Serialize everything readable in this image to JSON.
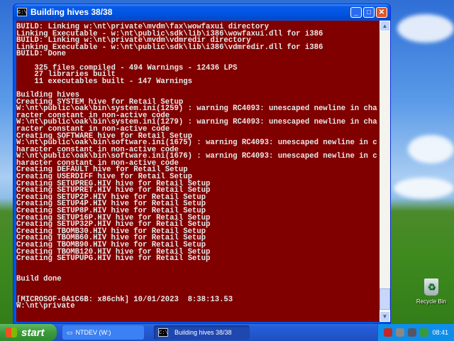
{
  "window": {
    "title": "Building hives 38/38",
    "icon": "C:\\"
  },
  "console_lines": [
    "BUILD: Linking w:\\nt\\private\\mvdm\\fax\\wowfaxui directory",
    "Linking Executable - w:\\nt\\public\\sdk\\lib\\i386\\wowfaxui.dll for i386",
    "BUILD: Linking w:\\nt\\private\\mvdm\\vdmredir directory",
    "Linking Executable - w:\\nt\\public\\sdk\\lib\\i386\\vdmredir.dll for i386",
    "BUILD: Done",
    "",
    "    325 files compiled - 494 Warnings - 12436 LPS",
    "    27 libraries built",
    "    11 executables built - 147 Warnings",
    "",
    "Building hives",
    "Creating SYSTEM hive for Retail Setup",
    "W:\\nt\\public\\oak\\bin\\system.ini(1259) : warning RC4093: unescaped newline in cha",
    "racter constant in non-active code",
    "W:\\nt\\public\\oak\\bin\\system.ini(1279) : warning RC4093: unescaped newline in cha",
    "racter constant in non-active code",
    "Creating SOFTWARE hive for Retail Setup",
    "W:\\nt\\public\\oak\\bin\\software.ini(1675) : warning RC4093: unescaped newline in c",
    "haracter constant in non-active code",
    "W:\\nt\\public\\oak\\bin\\software.ini(1676) : warning RC4093: unescaped newline in c",
    "haracter constant in non-active code",
    "Creating DEFAULT hive for Retail Setup",
    "Creating USERDIFF hive for Retail Setup",
    "Creating SETUPREG.HIV hive for Retail Setup",
    "Creating SETUPRET.HIV hive for Retail Setup",
    "Creating SETUP2P.HIV hive for Retail Setup",
    "Creating SETUP4P.HIV hive for Retail Setup",
    "Creating SETUP8P.HIV hive for Retail Setup",
    "Creating SETUP16P.HIV hive for Retail Setup",
    "Creating SETUP32P.HIV hive for Retail Setup",
    "Creating TBOMB30.HIV hive for Retail Setup",
    "Creating TBOMB60.HIV hive for Retail Setup",
    "Creating TBOMB90.HIV hive for Retail Setup",
    "Creating TBOMB120.HIV hive for Retail Setup",
    "Creating SETUPUPG.HIV hive for Retail Setup",
    "",
    "",
    "Build done",
    "",
    "",
    "[MICROSOF-0A1C6B: x86chk] 10/01/2023  8:38:13.53",
    "W:\\nt\\private",
    "",
    "_"
  ],
  "desktop": {
    "recycle_bin": "Recycle Bin"
  },
  "taskbar": {
    "start": "start",
    "tasks": [
      "NTDEV (W:)",
      "Building hives 38/38"
    ],
    "clock": "08:41"
  }
}
